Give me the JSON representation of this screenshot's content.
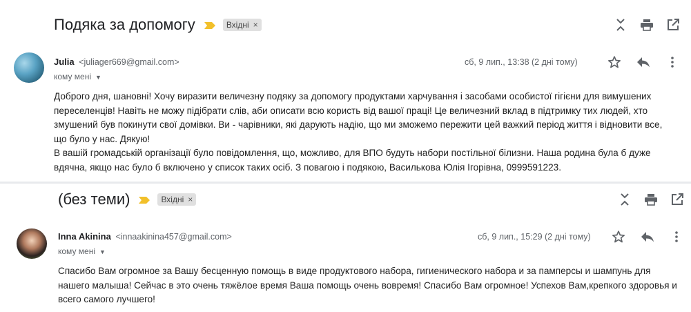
{
  "threads": [
    {
      "subject": "Подяка за допомогу",
      "label": "Вхідні",
      "label_remove": "×",
      "message": {
        "sender_name": "Julia",
        "sender_email": "<juliager669@gmail.com>",
        "to": "кому мені",
        "date": "сб, 9 лип., 13:38 (2 дні тому)",
        "body": [
          "Доброго дня, шановні! Хочу виразити величезну подяку за допомогу продуктами харчування і засобами особистої гігієни для вимушених переселенців! Навіть не можу підібрати слів, аби описати всю користь від вашої праці! Це величезний вклад в підтримку тих людей, хто змушений був покинути свої домівки. Ви - чарівники, які дарують надію, що ми зможемо пережити цей важкий період життя і відновити все, що було у нас. Дякую!",
          "В вашій громадській організації було повідомлення, що, можливо, для ВПО будуть набори постільної білизни. Наша родина була б дуже вдячна, якщо нас було б включено у список таких осіб. З повагою і подякою, Василькова Юлія Ігорівна, 0999591223."
        ]
      }
    },
    {
      "subject": "(без теми)",
      "label": "Вхідні",
      "label_remove": "×",
      "message": {
        "sender_name": "Inna Akinina",
        "sender_email": "<innaakinina457@gmail.com>",
        "to": "кому мені",
        "date": "сб, 9 лип., 15:29 (2 дні тому)",
        "body": [
          "Спасибо Вам огромное за Вашу бесценную помощь в виде продуктового набора, гигиенического набора и за памперсы и шампунь для нашего малыша! Сейчас в это очень тяжёлое время Ваша помощь очень вовремя! Спасибо Вам огромное! Успехов Вам,крепкого здоровья и всего самого лучшего!"
        ]
      }
    }
  ],
  "icons": {
    "collapse": "collapse-all-icon",
    "print": "print-icon",
    "open_new_window": "open-in-new-window-icon",
    "star": "star-icon",
    "reply": "reply-icon",
    "more": "more-vert-icon",
    "importance": "importance-marker-icon"
  },
  "colors": {
    "importance_marker": "#f2c02a",
    "label_chip_bg": "#e0e0e0",
    "icon_gray": "#5f6368"
  }
}
